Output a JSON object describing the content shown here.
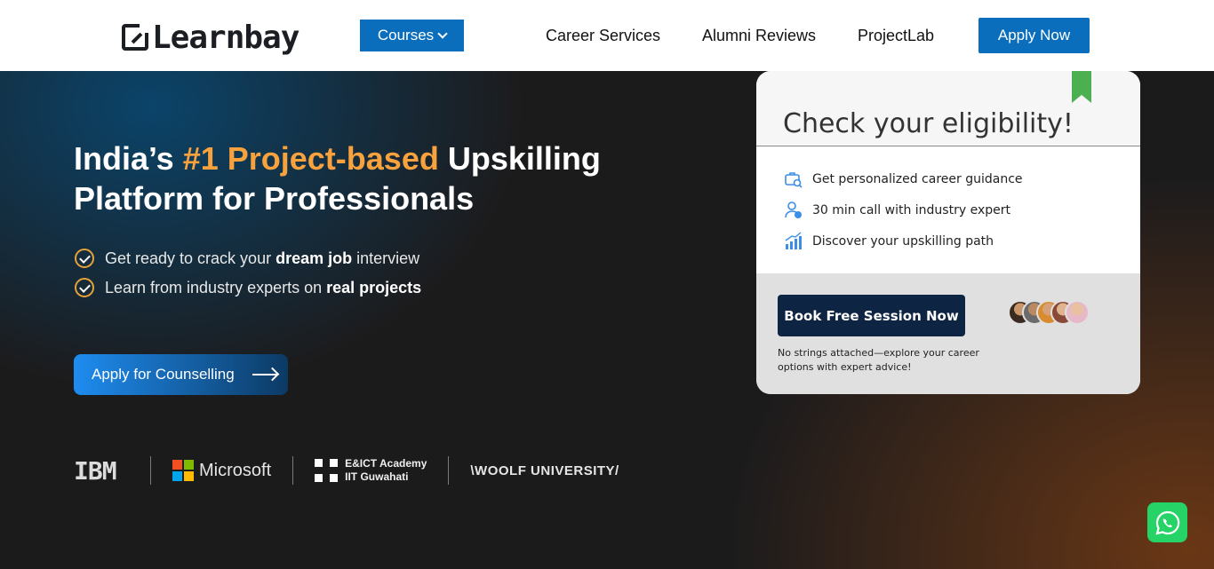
{
  "header": {
    "logo_text": "Learnbay",
    "courses_label": "Courses",
    "nav": [
      "Career Services",
      "Alumni Reviews",
      "ProjectLab"
    ],
    "apply_label": "Apply Now"
  },
  "hero": {
    "title_part1": "India’s ",
    "title_highlight": "#1 Project-based",
    "title_part2": " Upskilling Platform for Professionals",
    "bullet1_pre": "Get ready to crack your ",
    "bullet1_bold": "dream job",
    "bullet1_post": " interview",
    "bullet2_pre": "Learn from industry experts on ",
    "bullet2_bold": "real projects",
    "cta_label": "Apply for Counselling",
    "partners": {
      "ibm": "IBM",
      "microsoft": "Microsoft",
      "eict_line1": "E&ICT Academy",
      "eict_line2": "IIT Guwahati",
      "woolf": "\\WOOLF UNIVERSITY/"
    }
  },
  "card": {
    "title": "Check your eligibility!",
    "features": [
      {
        "icon": "briefcase-search-icon",
        "text": "Get personalized career guidance"
      },
      {
        "icon": "user-call-icon",
        "text": "30 min call with industry expert"
      },
      {
        "icon": "growth-chart-icon",
        "text": "Discover your upskilling path"
      }
    ],
    "book_label": "Book Free Session Now",
    "note": "No strings attached—explore your career options with expert advice!"
  },
  "colors": {
    "brand_blue": "#0a6ebd",
    "highlight_orange": "#f7a23c",
    "dark_navy": "#0d2442",
    "whatsapp_green": "#25d366",
    "ribbon_green": "#4caf50"
  }
}
